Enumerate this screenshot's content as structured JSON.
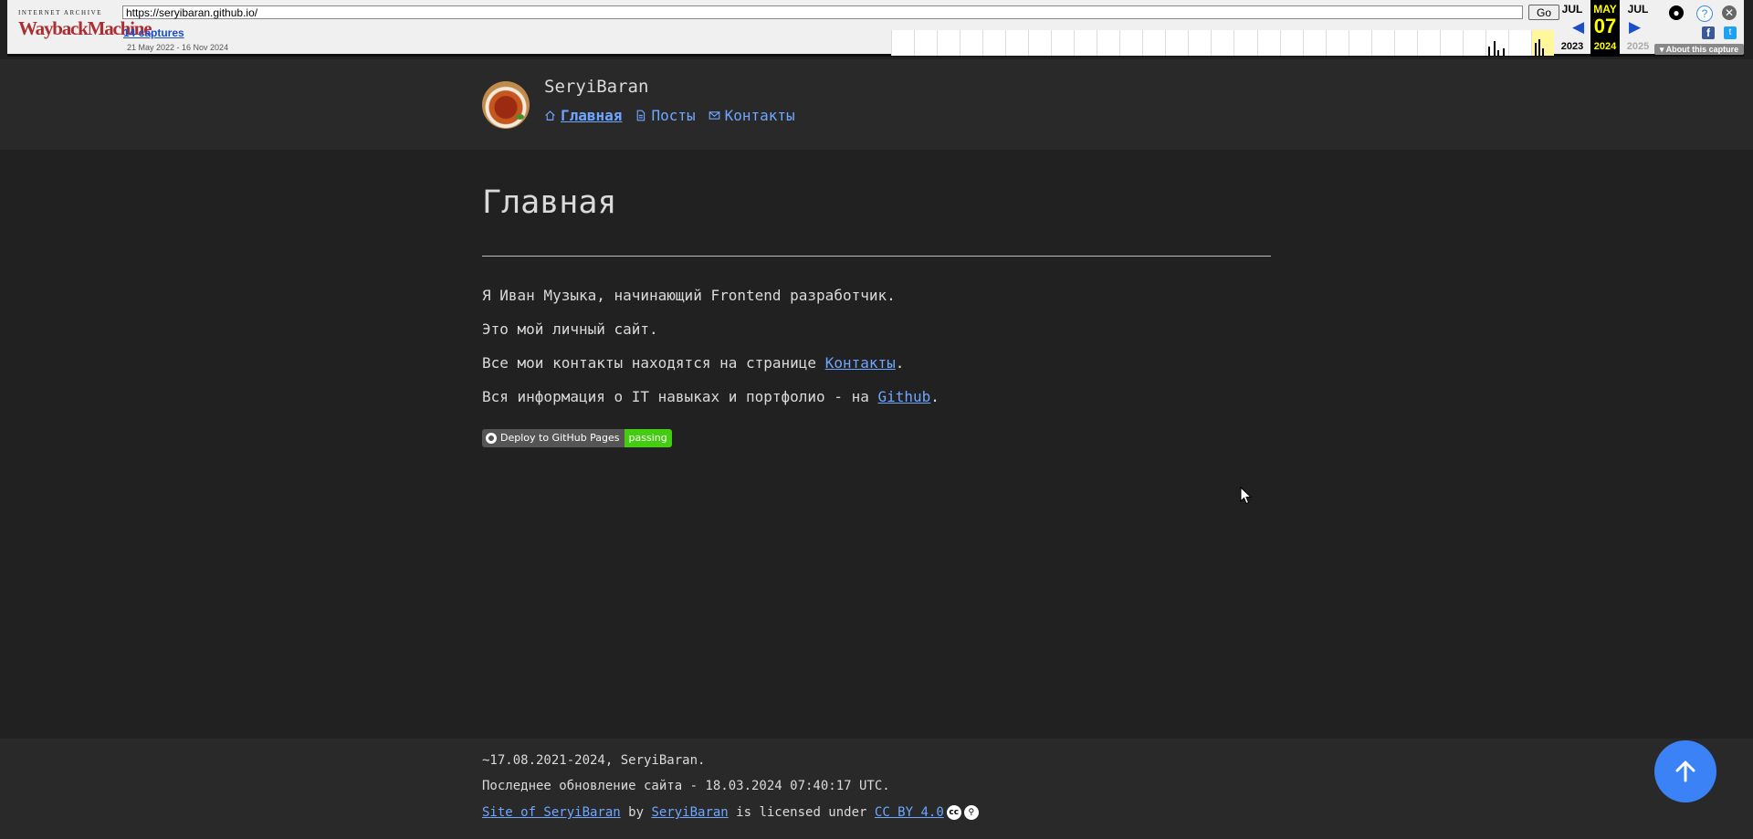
{
  "wayback": {
    "logo_top": "INTERNET ARCHIVE",
    "logo_main": "WaybackMachine",
    "url": "https://seryibaran.github.io/",
    "go_label": "Go",
    "captures_label": "14 captures",
    "date_range": "21 May 2022 - 16 Nov 2024",
    "prev_month": "JUL",
    "prev_year": "2023",
    "cur_month": "MAY",
    "cur_day": "07",
    "cur_year": "2024",
    "next_month": "JUL",
    "next_year": "2025",
    "about_label": "About this capture",
    "icons": [
      "prev-arrow-icon",
      "next-arrow-icon",
      "user-icon",
      "help-icon",
      "close-icon",
      "facebook-icon",
      "twitter-icon"
    ]
  },
  "header": {
    "site_title": "SeryiBaran",
    "nav": [
      {
        "label": "Главная",
        "icon": "home-icon",
        "active": true
      },
      {
        "label": "Посты",
        "icon": "document-icon",
        "active": false
      },
      {
        "label": "Контакты",
        "icon": "mail-icon",
        "active": false
      }
    ]
  },
  "main": {
    "title": "Главная",
    "p1": "Я Иван Музыка, начинающий Frontend разработчик.",
    "p2": "Это мой личный сайт.",
    "p3_before": "Все мои контакты находятся на странице ",
    "p3_link": "Контакты",
    "p3_after": ".",
    "p4_before": "Вся информация о IT навыках и портфолио - на ",
    "p4_link": "Github",
    "p4_after": ".",
    "badge_left": "Deploy to GitHub Pages",
    "badge_right": "passing"
  },
  "footer": {
    "line1": "~17.08.2021-2024, SeryiBaran.",
    "line2": "Последнее обновление сайта - 18.03.2024 07:40:17 UTC.",
    "site_link": "Site of SeryiBaran",
    "by": " by ",
    "author_link": "SeryiBaran",
    "licensed": " is licensed under ",
    "license_link": "CC BY 4.0",
    "cc_icons": [
      "cc-icon",
      "by-icon"
    ]
  },
  "colors": {
    "background": "#212121",
    "header_bg": "#292929",
    "link": "#6fa6ff",
    "to_top_button": "#3b82f6"
  }
}
